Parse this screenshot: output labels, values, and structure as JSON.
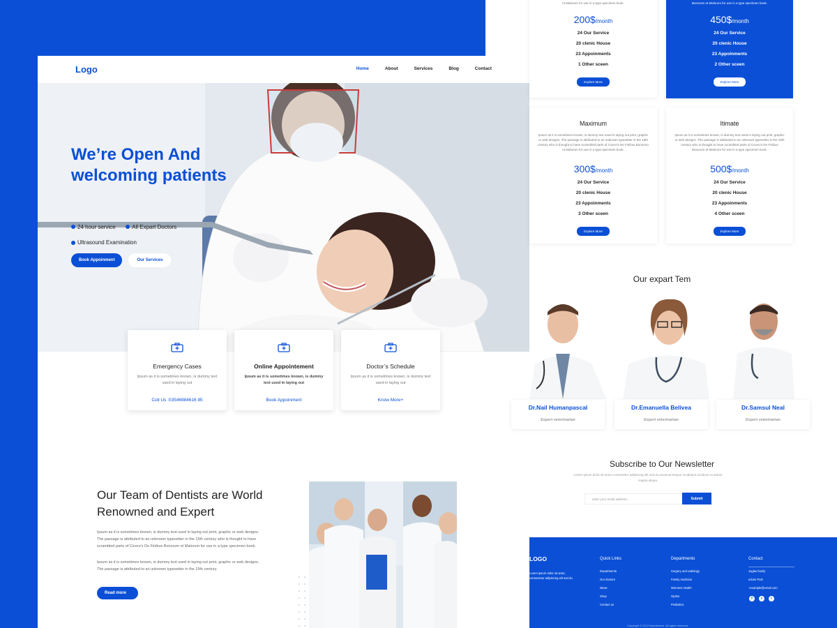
{
  "colors": {
    "primary": "#0a4fd6",
    "background": "#ffffff"
  },
  "left": {
    "logo": "Logo",
    "nav": [
      "Home",
      "About",
      "Services",
      "Blog",
      "Contact"
    ],
    "hero": {
      "title": "We’re Open And welcoming patients",
      "bullets": [
        "24 hour service",
        "All Expart Doctors",
        "Ultrasound Examination"
      ],
      "btn_primary": "Book Appoinment",
      "btn_secondary": "Our Services"
    },
    "cards": [
      {
        "icon": "medical-kit-icon",
        "title": "Emergency Cases",
        "desc": "Ipsum as it is sometimes known, is dummy text used in laying out",
        "link": "Coll Us :03546984616 85"
      },
      {
        "icon": "medical-kit-icon",
        "title": "Online Appointement",
        "desc": "Ipsum as it is sometimes known, is dummy text used in laying out",
        "link": "Book Appoinment"
      },
      {
        "icon": "medical-kit-icon",
        "title": "Doctor’s  Schedule",
        "desc": "Ipsum as it is sometimes known, is dummy text used in laying out",
        "link": "Know More+"
      }
    ],
    "team": {
      "title": "Our Team of Dentists are World Renowned and Expert",
      "p1": "Ipsum as it is sometimes known, is dummy text used in laying out print, graphic or web designs. The passage is attributed to an unknown typesetter in the 15th century who is thought to have scrambled parts of Cicero's De Finibus Bonorum et Malorum for use in a type specimen book.",
      "p2": "Ipsum as it is sometimes known, is dummy text used in laying out print, graphic or web designs. The passage is attributed to an unknown typesetter in the 15th century.",
      "btn": "Read more"
    }
  },
  "right": {
    "pricing": [
      {
        "name": "",
        "desc": "century who is thought to have scrambled parts of Cicero's De Finibus Bonorum et Malorum for use in a type specimen book.",
        "price": "200$",
        "period": "/month",
        "features": [
          "24 Our Service",
          "20 clenic House",
          "23 Appoinments",
          "1 Other sceen"
        ],
        "btn": "Explore More",
        "highlight": false
      },
      {
        "name": "",
        "desc": "century who is thought to have scrambled parts of Cicero's De Finibus Bonorum et Malorum for use in a type specimen book.",
        "price": "450$",
        "period": "/month",
        "features": [
          "24 Our Service",
          "20 clenic House",
          "23 Appoinments",
          "2 Other sceen"
        ],
        "btn": "Explore More",
        "highlight": true
      },
      {
        "name": "Maximum",
        "desc": "Ipsum as it is sometimes known, is dummy text used in laying out print, graphic or web designs. The passage is attributed to an unknown typesetter in the 15th century who is thought to have scrambled parts of Cicero's De Finibus Bonorum et Malorum for use in a type specimen book.",
        "price": "300$",
        "period": "/month",
        "features": [
          "24 Our Service",
          "20 clenic House",
          "23 Appoinments",
          "3 Other sceen"
        ],
        "btn": "Explore More",
        "highlight": false
      },
      {
        "name": "Itimate",
        "desc": "Ipsum as it is sometimes known, is dummy text used in laying out print, graphic or web designs. The passage is attributed to an unknown typesetter in the 15th century who is thought to have scrambled parts of Cicero's De Finibus Bonorum et Malorum for use in a type specimen book.",
        "price": "500$",
        "period": "/month",
        "features": [
          "24 Our Service",
          "20 clenic House",
          "23 Appoinments",
          "4 Other sceen"
        ],
        "btn": "Explore More",
        "highlight": false
      }
    ],
    "experts_title": "Our expart Tem",
    "doctors": [
      {
        "name": "Dr.Nail Humanpascal",
        "role": "Expert veterinarian"
      },
      {
        "name": "Dr.Emanuella Belivea",
        "role": "Expert veterinarian"
      },
      {
        "name": "Dr.Samsul Neal",
        "role": "Expert veterinarian"
      }
    ],
    "newsletter": {
      "title": "Subscribe to Our Newsletter",
      "sub": "Lorem ipsum dolor sit amet consectetur adipiscing elit sed do eiusmod tempor incididunt ut labore et dolore magna aliqua.",
      "placeholder": "enter your email address...",
      "btn": "Submit"
    },
    "footer": {
      "logo": "LOGO",
      "about": "Lorem ipsum dolor sit amet, consectetur adipiscing elit sed do.",
      "quick_title": "Quick Links",
      "quick": [
        "Departments",
        "Our doctors",
        "News",
        "Shop",
        "Contact us"
      ],
      "dept_title": "Departments",
      "dept": [
        "Surgery and radiology",
        "Family medicine",
        "Womens Health",
        "Option",
        "Pediatrics"
      ],
      "contact_title": "Contact",
      "contact": [
        "Joglas family",
        "eclam Post",
        "+example@email.com"
      ],
      "social": [
        "f",
        "t",
        "i"
      ],
      "copyright": "Copyright © 2021 Brandname. All rights reserved."
    }
  }
}
